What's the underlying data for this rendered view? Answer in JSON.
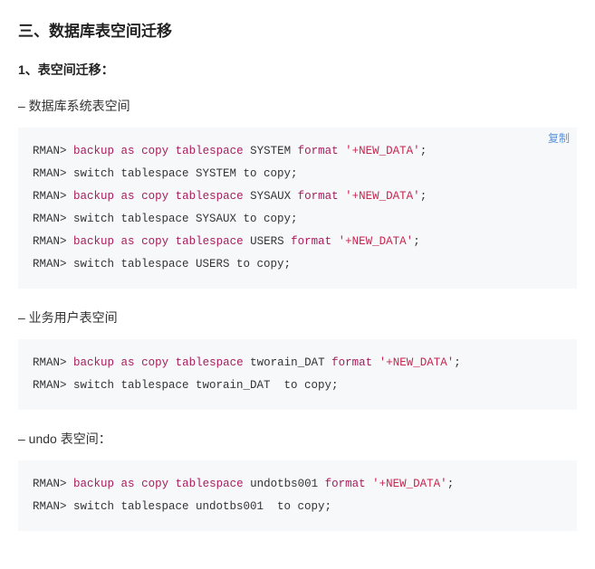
{
  "heading": "三、数据库表空间迁移",
  "section_title": "1、表空间迁移：",
  "copy_label": "复制",
  "blocks": [
    {
      "caption": "– 数据库系统表空间",
      "show_copy": true,
      "lines": [
        [
          {
            "t": "RMAN> "
          },
          {
            "t": "backup",
            "c": "kw"
          },
          {
            "t": " "
          },
          {
            "t": "as",
            "c": "kw"
          },
          {
            "t": " "
          },
          {
            "t": "copy",
            "c": "kw"
          },
          {
            "t": " "
          },
          {
            "t": "tablespace",
            "c": "kw"
          },
          {
            "t": " SYSTEM "
          },
          {
            "t": "format",
            "c": "kw"
          },
          {
            "t": " "
          },
          {
            "t": "'+NEW_DATA'",
            "c": "str"
          },
          {
            "t": ";"
          }
        ],
        [
          {
            "t": "RMAN> switch tablespace SYSTEM to copy;"
          }
        ],
        [
          {
            "t": "RMAN> "
          },
          {
            "t": "backup",
            "c": "kw"
          },
          {
            "t": " "
          },
          {
            "t": "as",
            "c": "kw"
          },
          {
            "t": " "
          },
          {
            "t": "copy",
            "c": "kw"
          },
          {
            "t": " "
          },
          {
            "t": "tablespace",
            "c": "kw"
          },
          {
            "t": " SYSAUX "
          },
          {
            "t": "format",
            "c": "kw"
          },
          {
            "t": " "
          },
          {
            "t": "'+NEW_DATA'",
            "c": "str"
          },
          {
            "t": ";"
          }
        ],
        [
          {
            "t": "RMAN> switch tablespace SYSAUX to copy;"
          }
        ],
        [
          {
            "t": "RMAN> "
          },
          {
            "t": "backup",
            "c": "kw"
          },
          {
            "t": " "
          },
          {
            "t": "as",
            "c": "kw"
          },
          {
            "t": " "
          },
          {
            "t": "copy",
            "c": "kw"
          },
          {
            "t": " "
          },
          {
            "t": "tablespace",
            "c": "kw"
          },
          {
            "t": " USERS "
          },
          {
            "t": "format",
            "c": "kw"
          },
          {
            "t": " "
          },
          {
            "t": "'+NEW_DATA'",
            "c": "str"
          },
          {
            "t": ";"
          }
        ],
        [
          {
            "t": "RMAN> switch tablespace USERS to copy;"
          }
        ]
      ]
    },
    {
      "caption": "– 业务用户表空间",
      "show_copy": false,
      "lines": [
        [
          {
            "t": "RMAN> "
          },
          {
            "t": "backup",
            "c": "kw"
          },
          {
            "t": " "
          },
          {
            "t": "as",
            "c": "kw"
          },
          {
            "t": " "
          },
          {
            "t": "copy",
            "c": "kw"
          },
          {
            "t": " "
          },
          {
            "t": "tablespace",
            "c": "kw"
          },
          {
            "t": " tworain_DAT "
          },
          {
            "t": "format",
            "c": "kw"
          },
          {
            "t": " "
          },
          {
            "t": "'+NEW_DATA'",
            "c": "str"
          },
          {
            "t": ";"
          }
        ],
        [
          {
            "t": "RMAN> switch tablespace tworain_DAT  to copy;"
          }
        ]
      ]
    },
    {
      "caption": "– undo 表空间：",
      "show_copy": false,
      "lines": [
        [
          {
            "t": "RMAN> "
          },
          {
            "t": "backup",
            "c": "kw"
          },
          {
            "t": " "
          },
          {
            "t": "as",
            "c": "kw"
          },
          {
            "t": " "
          },
          {
            "t": "copy",
            "c": "kw"
          },
          {
            "t": " "
          },
          {
            "t": "tablespace",
            "c": "kw"
          },
          {
            "t": " undotbs001 "
          },
          {
            "t": "format",
            "c": "kw"
          },
          {
            "t": " "
          },
          {
            "t": "'+NEW_DATA'",
            "c": "str"
          },
          {
            "t": ";"
          }
        ],
        [
          {
            "t": "RMAN> switch tablespace undotbs001  to copy;"
          }
        ]
      ]
    }
  ]
}
